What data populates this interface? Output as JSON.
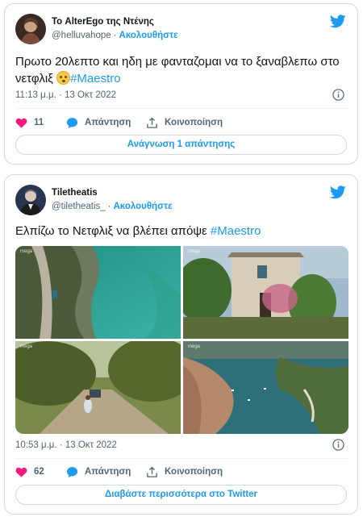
{
  "tweets": [
    {
      "display_name": "Το AlterEgo της Ντένης",
      "handle": "@helluvahope",
      "follow_label": "Ακολουθήστε",
      "text_main": "Πρωτο 20λεπτο και ηδη με φανταζομαι να το ξαναβλεπω στο νετφλιξ ",
      "hashtag": "#Maestro",
      "timestamp": "11:13 μ.μ. · 13 Οκτ 2022",
      "like_count": "11",
      "reply_label": "Απάντηση",
      "share_label": "Κοινοποίηση",
      "pill_label": "Ανάγνωση 1 απάντησης"
    },
    {
      "display_name": "Tiletheatis",
      "handle": "@tiletheatis_",
      "follow_label": "Ακολουθήστε",
      "text_main": "Ελπίζω το Νετφλιξ να βλέπει απόψε ",
      "hashtag": "#Maestro",
      "timestamp": "10:53 μ.μ. · 13 Οκτ 2022",
      "like_count": "62",
      "reply_label": "Απάντηση",
      "share_label": "Κοινοποίηση",
      "pill_label": "Διαβάστε περισσότερα στο Twitter",
      "media_watermark": "mega"
    }
  ],
  "colors": {
    "accent": "#1d9bf0",
    "like": "#f91880",
    "muted": "#536471",
    "border": "#cfd9de"
  },
  "icons": [
    "twitter-bird-icon",
    "info-icon",
    "heart-icon",
    "reply-bubble-icon",
    "share-icon",
    "smiley-emoji-icon"
  ]
}
